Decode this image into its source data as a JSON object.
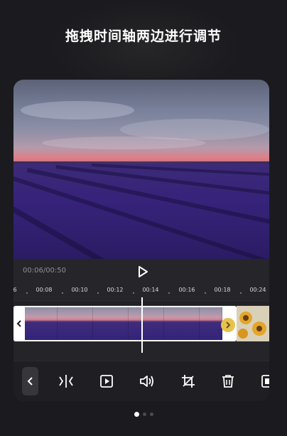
{
  "headline": "拖拽时间轴两边进行调节",
  "player": {
    "timecode": "00:06/00:50"
  },
  "ruler": {
    "ticks": [
      "6",
      "00:08",
      "00:10",
      "00:12",
      "00:14",
      "00:16",
      "00:18",
      "00:24"
    ]
  },
  "colors": {
    "background": "#1b1b1f",
    "card": "#28282b",
    "clip_border": "#ffffff",
    "knob": "#e7c14e",
    "lavender": "#36237a"
  },
  "toolbar": {
    "icons": [
      "back-icon",
      "split-icon",
      "preview-icon",
      "volume-icon",
      "crop-icon",
      "delete-icon",
      "more-icon"
    ]
  },
  "pager": {
    "count": 3,
    "active": 1
  }
}
